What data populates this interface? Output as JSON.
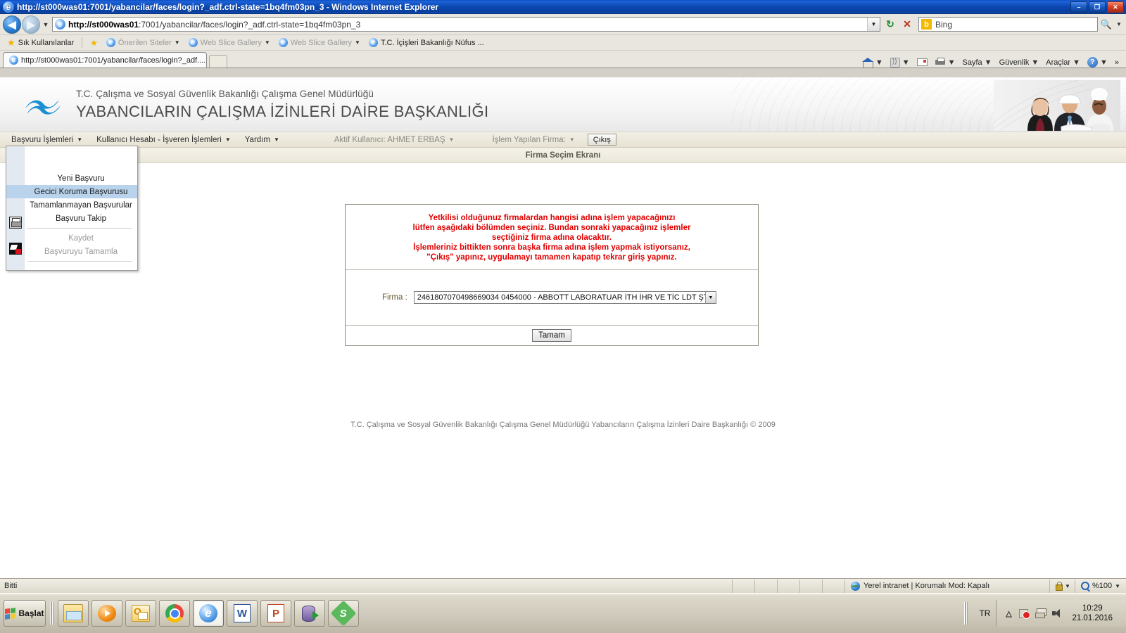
{
  "window": {
    "title": "http://st000was01:7001/yabancilar/faces/login?_adf.ctrl-state=1bq4fm03pn_3 - Windows Internet Explorer",
    "minimize": "–",
    "maximize": "❐",
    "close": "✕"
  },
  "browser": {
    "back_icon": "◀",
    "forward_icon": "▶",
    "history_caret": "▼",
    "address_host": "http://st000was01",
    "address_rest": ":7001/yabancilar/faces/login?_adf.ctrl-state=1bq4fm03pn_3",
    "address_caret": "▼",
    "refresh_icon": "↻",
    "stop_icon": "✕",
    "search_engine": "Bing",
    "search_go_icon": "🔍",
    "search_caret": "▼"
  },
  "favorites": {
    "label": "Sık Kullanılanlar",
    "items": [
      {
        "label": "Önerilen Siteler",
        "caret": "▼",
        "dim": true
      },
      {
        "label": "Web Slice Gallery",
        "caret": "▼",
        "dim": true
      },
      {
        "label": "Web Slice Gallery",
        "caret": "▼",
        "dim": true
      },
      {
        "label": "T.C. İçişleri Bakanlığı Nüfus ...",
        "caret": "",
        "dim": false
      }
    ]
  },
  "tabs": {
    "active_tab": "http://st000was01:7001/yabancilar/faces/login?_adf....",
    "new_tab_tooltip": ""
  },
  "command_bar": {
    "home": "",
    "feeds": "",
    "mail": "",
    "print": "",
    "page": "Sayfa",
    "safety": "Güvenlik",
    "tools": "Araçlar",
    "help": "",
    "caret": "▼",
    "overflow": "»"
  },
  "page": {
    "banner": {
      "line1": "T.C. Çalışma ve Sosyal Güvenlik Bakanlığı Çalışma Genel Müdürlüğü",
      "line2": "YABANCILARIN ÇALIŞMA İZİNLERİ DAİRE BAŞKANLIĞI"
    },
    "menu": {
      "items": [
        {
          "label": "Başvuru İşlemleri",
          "caret": "▼",
          "dim": false
        },
        {
          "label": "Kullanıcı Hesabı - İşveren İşlemleri",
          "caret": "▼",
          "dim": false
        },
        {
          "label": "Yardım",
          "caret": "▼",
          "dim": false
        },
        {
          "label": "Aktif Kullanıcı: AHMET ERBAŞ",
          "caret": "▼",
          "dim": true
        },
        {
          "label": "İşlem Yapılan Firma:",
          "caret": "▼",
          "dim": true
        }
      ],
      "exit_button": "Çıkış"
    },
    "screen_title": "Firma Seçim Ekranı",
    "dropdown": {
      "items": [
        {
          "label": "Yeni Başvuru",
          "highlighted": false,
          "disabled": false
        },
        {
          "label": "Gecici Koruma Başvurusu",
          "highlighted": true,
          "disabled": false
        },
        {
          "label": "Tamamlanmayan Başvurular",
          "highlighted": false,
          "disabled": false
        },
        {
          "label": "Başvuru Takip",
          "highlighted": false,
          "disabled": false
        },
        {
          "label": "Kaydet",
          "highlighted": false,
          "disabled": true
        },
        {
          "label": "Başvuruyu Tamamla",
          "highlighted": false,
          "disabled": true
        }
      ],
      "icons": [
        "save-floppy-icon",
        "complete-application-icon"
      ]
    },
    "form": {
      "warning_lines": [
        "Yetkilisi olduğunuz firmalardan hangisi adına işlem yapacağınızı",
        "lütfen aşağıdaki bölümden seçiniz. Bundan sonraki yapacağınız işlemler",
        "seçtiğiniz firma adına olacaktır.",
        "İşlemleriniz bittikten sonra başka firma adına işlem yapmak istiyorsanız,",
        "\"Çıkış\" yapınız, uygulamayı tamamen kapatıp tekrar giriş yapınız."
      ],
      "warning_color": "#e00000",
      "firma_label": "Firma :",
      "firma_value": "2461807070498669034 0454000 - ABBOTT LABORATUAR İTH İHR VE TİC LDT ŞTİ",
      "firma_caret": "▼",
      "submit_button": "Tamam"
    },
    "copyright": "T.C. Çalışma ve Sosyal Güvenlik Bakanlığı Çalışma Genel Müdürlüğü Yabancıların Çalışma İzinleri Daire Başkanlığı © 2009"
  },
  "status_bar": {
    "text": "Bitti",
    "zone": "Yerel intranet | Korumalı Mod: Kapalı",
    "zoom": "%100",
    "zoom_caret": "▼",
    "security_caret": "▼"
  },
  "taskbar": {
    "start_label": "Başlat",
    "items": [
      {
        "name": "windows-explorer",
        "icon": "folder-icon"
      },
      {
        "name": "media-player",
        "icon": "media-player-icon"
      },
      {
        "name": "outlook",
        "icon": "outlook-icon"
      },
      {
        "name": "google-chrome",
        "icon": "chrome-icon"
      },
      {
        "name": "internet-explorer",
        "icon": "ie-icon",
        "active": true
      },
      {
        "name": "microsoft-word",
        "icon": "word-icon",
        "letter": "W"
      },
      {
        "name": "powerpoint",
        "icon": "powerpoint-icon",
        "letter": "P"
      },
      {
        "name": "database-tool",
        "icon": "database-icon"
      },
      {
        "name": "s-app",
        "icon": "s-app-icon",
        "letter": "S"
      }
    ],
    "language": "TR",
    "clock_time": "10:29",
    "clock_date": "21.01.2016",
    "tray_icons": [
      "show-hidden-icons",
      "network-disconnected-icon",
      "display-icon",
      "volume-icon"
    ]
  }
}
